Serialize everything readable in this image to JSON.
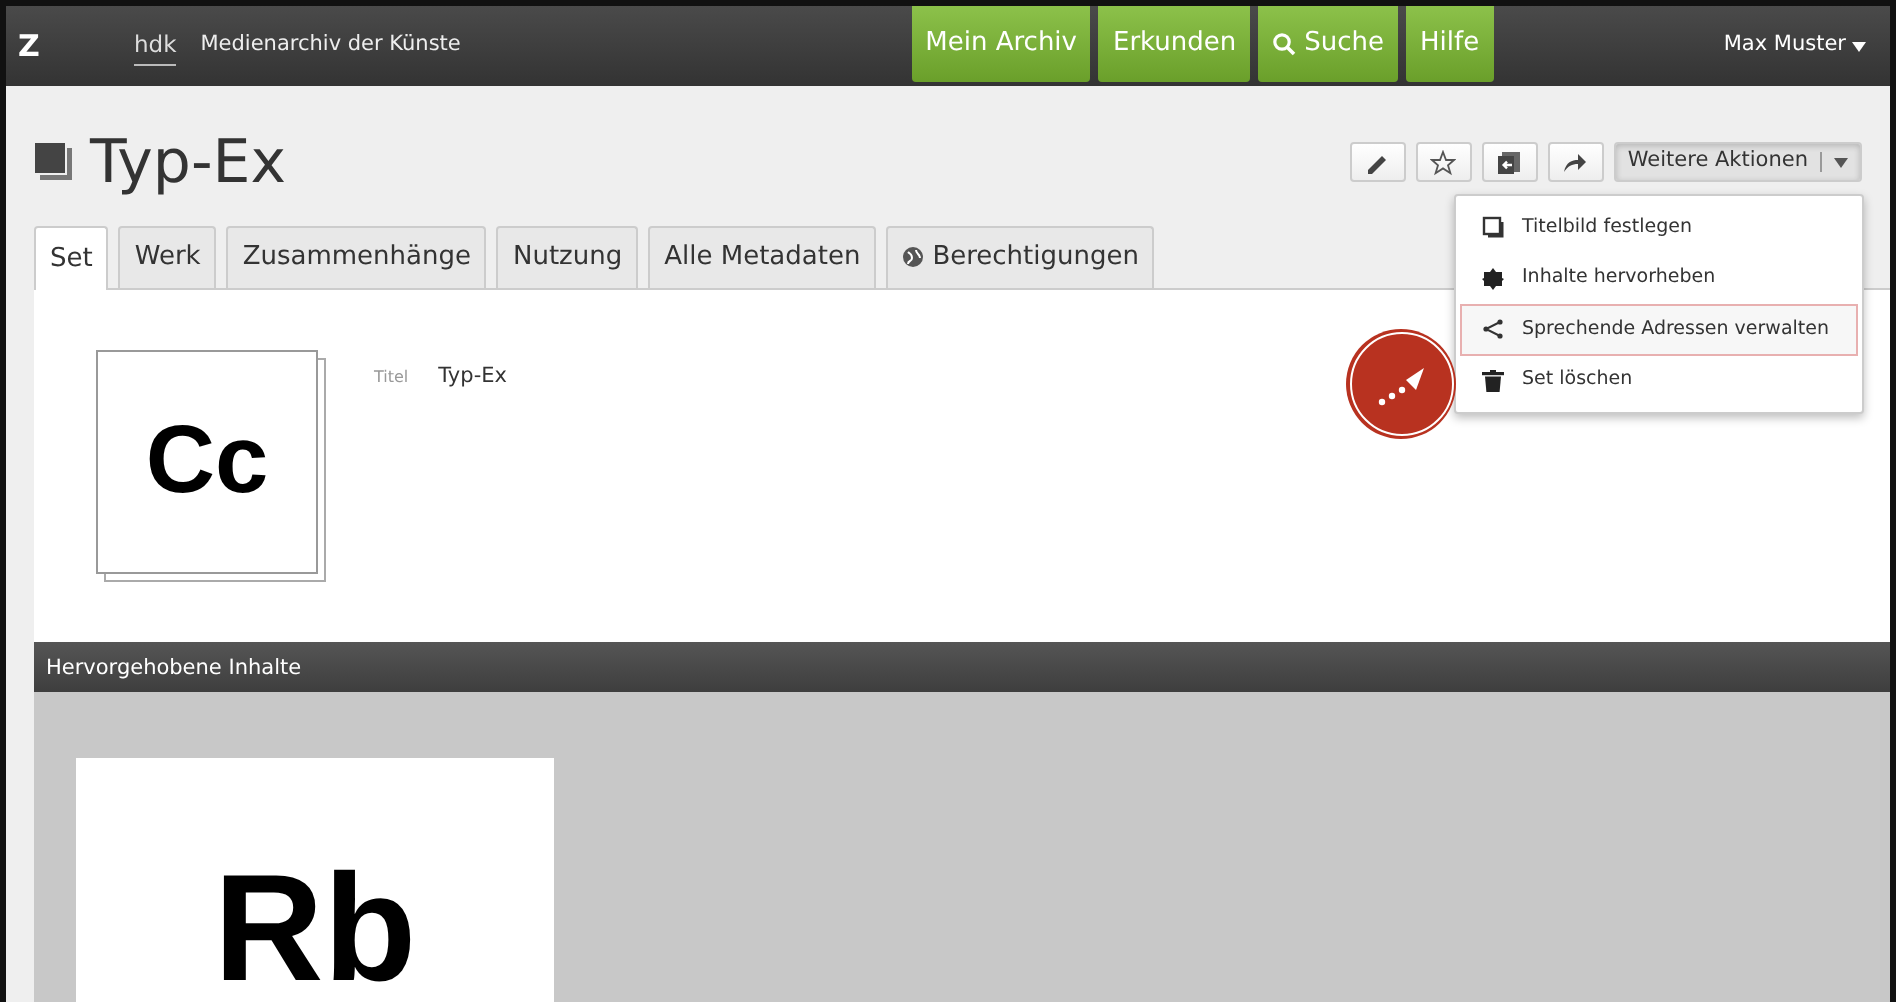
{
  "header": {
    "logo": "Z",
    "school": "hdk",
    "app_name": "Medienarchiv der Künste",
    "nav": [
      {
        "label": "Mein Archiv",
        "kind": "plain"
      },
      {
        "label": "Erkunden",
        "kind": "plain"
      },
      {
        "label": "Suche",
        "kind": "search"
      },
      {
        "label": "Hilfe",
        "kind": "plain"
      }
    ],
    "user": "Max Muster"
  },
  "title": "Typ-Ex",
  "toolbar": [
    {
      "kind": "edit"
    },
    {
      "kind": "favorite"
    },
    {
      "kind": "export"
    },
    {
      "kind": "share"
    }
  ],
  "more_actions": {
    "label": "Weitere Aktionen",
    "expanded": true,
    "items": [
      {
        "label": "Titelbild festlegen",
        "kind": "cover",
        "highlighted": false
      },
      {
        "label": "Inhalte hervorheben",
        "kind": "highlight",
        "highlighted": false
      },
      {
        "label": "Sprechende Adressen verwalten",
        "kind": "share",
        "highlighted": true
      },
      {
        "label": "Set löschen",
        "kind": "delete",
        "highlighted": false
      }
    ]
  },
  "tabs": [
    {
      "label": "Set",
      "kind": "plain",
      "selected": true
    },
    {
      "label": "Werk",
      "kind": "plain",
      "selected": false
    },
    {
      "label": "Zusammenhänge",
      "kind": "plain",
      "selected": false
    },
    {
      "label": "Nutzung",
      "kind": "plain",
      "selected": false
    },
    {
      "label": "Alle Metadaten",
      "kind": "plain",
      "selected": false
    },
    {
      "label": "Berechtigungen",
      "kind": "globe",
      "selected": false
    }
  ],
  "thumbnail": {
    "text": "Cc"
  },
  "metadata": [
    {
      "label": "Titel",
      "value": "Typ-Ex"
    }
  ],
  "highlighted_section": {
    "title": "Hervorgehobene Inhalte",
    "items": [
      {
        "text": "Rb"
      }
    ]
  }
}
